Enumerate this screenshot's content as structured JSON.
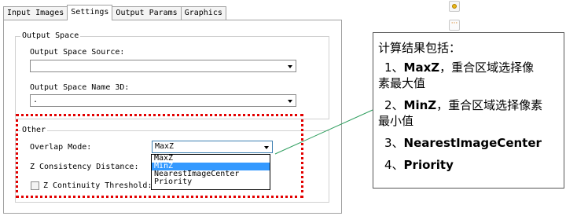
{
  "tabs": [
    {
      "label": "Input Images",
      "active": false
    },
    {
      "label": "Settings",
      "active": true
    },
    {
      "label": "Output Params",
      "active": false
    },
    {
      "label": "Graphics",
      "active": false
    }
  ],
  "output_space": {
    "legend": "Output Space",
    "source_label": "Output Space Source:",
    "source_value": "",
    "name3d_label": "Output Space Name 3D:",
    "name3d_value": "."
  },
  "other": {
    "legend": "Other",
    "overlap_label": "Overlap Mode:",
    "overlap_value": "MaxZ",
    "overlap_options": [
      "MaxZ",
      "MinZ",
      "NearestImageCenter",
      "Priority"
    ],
    "overlap_highlighted": "MinZ",
    "z_consistency_label": "Z Consistency Distance:",
    "z_continuity_label": "Z Continuity Threshold:",
    "z_continuity_checked": false
  },
  "callout": {
    "intro": "计算结果包括：",
    "item1_num": "1、",
    "item1_key": "MaxZ",
    "item1_desc_a": "，重合区域选择像",
    "item1_desc_b": "素最大值",
    "item2_num": "2、",
    "item2_key": "MinZ",
    "item2_desc_a": "，重合区域选择像素",
    "item2_desc_b": "最小值",
    "item3_num": "3、",
    "item3_key": "NearestImageCenter",
    "item4_num": "4、",
    "item4_key": "Priority"
  },
  "toolbar_icons": [
    "smiley-icon",
    "more-options-icon"
  ],
  "colors": {
    "highlight": "#3399ff",
    "annotation_border": "#e30000",
    "connector": "#2e9e5e"
  }
}
